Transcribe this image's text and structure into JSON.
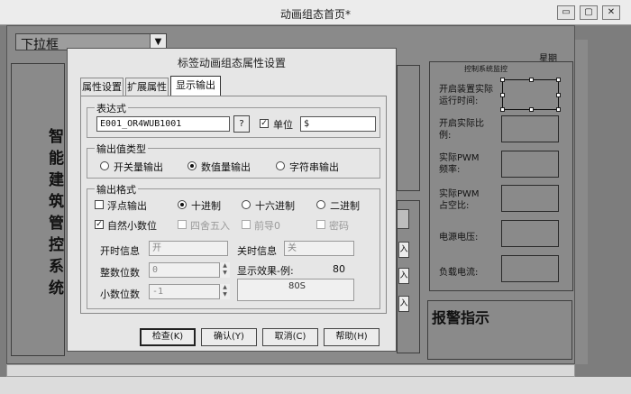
{
  "window": {
    "title": "动画组态首页*",
    "min_glyph": "▭",
    "restore_glyph": "▢",
    "close_glyph": "✕"
  },
  "dropdown": {
    "value": "下拉框",
    "arrow": "▼"
  },
  "right_panel": {
    "week_label": "星期",
    "section_title": "控制系统监控",
    "labels": [
      "开启装置实际运行时间:",
      "开启实际比例:",
      "实际PWM频率:",
      "实际PWM占空比:",
      "电源电压:",
      "负载电流:"
    ],
    "alarm_title": "报警指示"
  },
  "left_panel": {
    "vertical_chars": [
      "智",
      "能",
      "建",
      "筑",
      "管",
      "控",
      "系",
      "统"
    ]
  },
  "mid_panel": {
    "button_glyph": "入"
  },
  "dialog": {
    "title": "标签动画组态属性设置",
    "tabs": [
      "属性设置",
      "扩展属性",
      "显示输出"
    ],
    "expression": {
      "group": "表达式",
      "value": "E001_OR4WUB1001",
      "browse": "?",
      "unit_label": "单位",
      "unit_checked": true,
      "unit_value": "$"
    },
    "output_type": {
      "group": "输出值类型",
      "options": [
        "开关量输出",
        "数值量输出",
        "字符串输出"
      ],
      "selected": 1
    },
    "format": {
      "group": "输出格式",
      "float_label": "浮点输出",
      "radix": [
        "十进制",
        "十六进制",
        "二进制"
      ],
      "radix_selected": 0,
      "auto_decimal": "自然小数位",
      "round": "四舍五入",
      "leading_zero": "前导0",
      "password": "密码",
      "on_info_label": "开时信息",
      "on_info_value": "开",
      "off_info_label": "关时信息",
      "off_info_value": "关",
      "int_digits_label": "整数位数",
      "int_digits_value": "0",
      "dec_digits_label": "小数位数",
      "dec_digits_value": "-1",
      "preview_label": "显示效果-例:",
      "preview_example": "80",
      "preview_result": "80S"
    },
    "buttons": {
      "check": "检查(K)",
      "ok": "确认(Y)",
      "cancel": "取消(C)",
      "help": "帮助(H)"
    }
  }
}
